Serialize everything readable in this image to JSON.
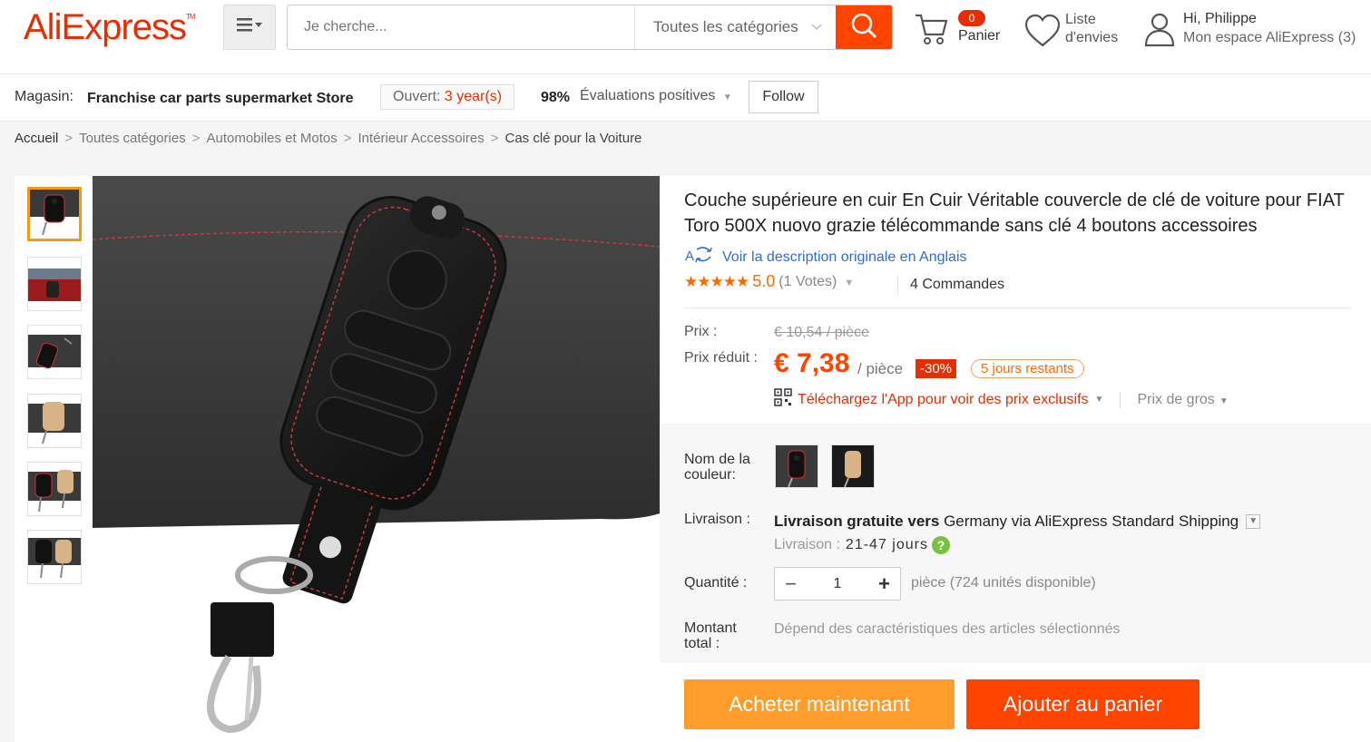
{
  "header": {
    "logo": "AliExpress",
    "logo_tm": "TM",
    "search_placeholder": "Je cherche...",
    "category_select": "Toutes les catégories",
    "cart_count": "0",
    "cart_label": "Panier",
    "wishlist_line1": "Liste",
    "wishlist_line2": "d'envies",
    "user_greeting": "Hi, Philippe",
    "user_space": "Mon espace AliExpress",
    "user_count": "(3)"
  },
  "store": {
    "label": "Magasin:",
    "name": "Franchise car parts supermarket Store",
    "open_label": "Ouvert:",
    "open_value": "3 year(s)",
    "positive_pct": "98%",
    "positive_label": "Évaluations positives",
    "follow": "Follow"
  },
  "breadcrumb": {
    "items": [
      "Accueil",
      "Toutes catégories",
      "Automobiles et Motos",
      "Intérieur Accessoires",
      "Cas clé pour la Voiture"
    ],
    "separator": ">"
  },
  "product": {
    "title": "Couche supérieure en cuir En Cuir Véritable couvercle de clé de voiture pour FIAT Toro 500X nuovo grazie télécommande sans clé 4 boutons accessoires",
    "translate_link": "Voir la description originale en Anglais",
    "rating_stars": 5,
    "rating_score": "5.0",
    "votes": "(1 Votes)",
    "orders": "4 Commandes",
    "price_label": "Prix :",
    "old_price": "€ 10,54 / pièce",
    "reduced_label": "Prix réduit :",
    "new_price": "€ 7,38",
    "unit": "/ pièce",
    "discount": "-30%",
    "days_left": "5 jours restants",
    "app_promo": "Téléchargez l'App pour voir des prix exclusifs",
    "wholesale": "Prix de gros",
    "color_label": "Nom de la couleur:",
    "shipping_label": "Livraison :",
    "shipping_free": "Livraison gratuite vers",
    "shipping_dest": "Germany via AliExpress Standard Shipping",
    "delivery_label": "Livraison :",
    "delivery_days": "21-47 jours",
    "quantity_label": "Quantité :",
    "quantity_value": "1",
    "quantity_avail": "pièce (724 unités disponible)",
    "total_label": "Montant total :",
    "total_value": "Dépend des caractéristiques des articles sélectionnés",
    "buy_now": "Acheter maintenant",
    "add_to_cart": "Ajouter au panier"
  },
  "colors": {
    "brand": "#e62e04",
    "accent_orange": "#ff4400",
    "buy_orange": "#ff9d2a",
    "link_blue": "#2d6ed3",
    "star_orange": "#ff6a00"
  },
  "icons": {
    "menu": "menu-icon",
    "search": "search-icon",
    "cart": "cart-icon",
    "wishlist": "heart-icon",
    "user": "user-icon",
    "translate": "translate-icon",
    "qr": "qr-code-icon",
    "help": "question-icon"
  }
}
